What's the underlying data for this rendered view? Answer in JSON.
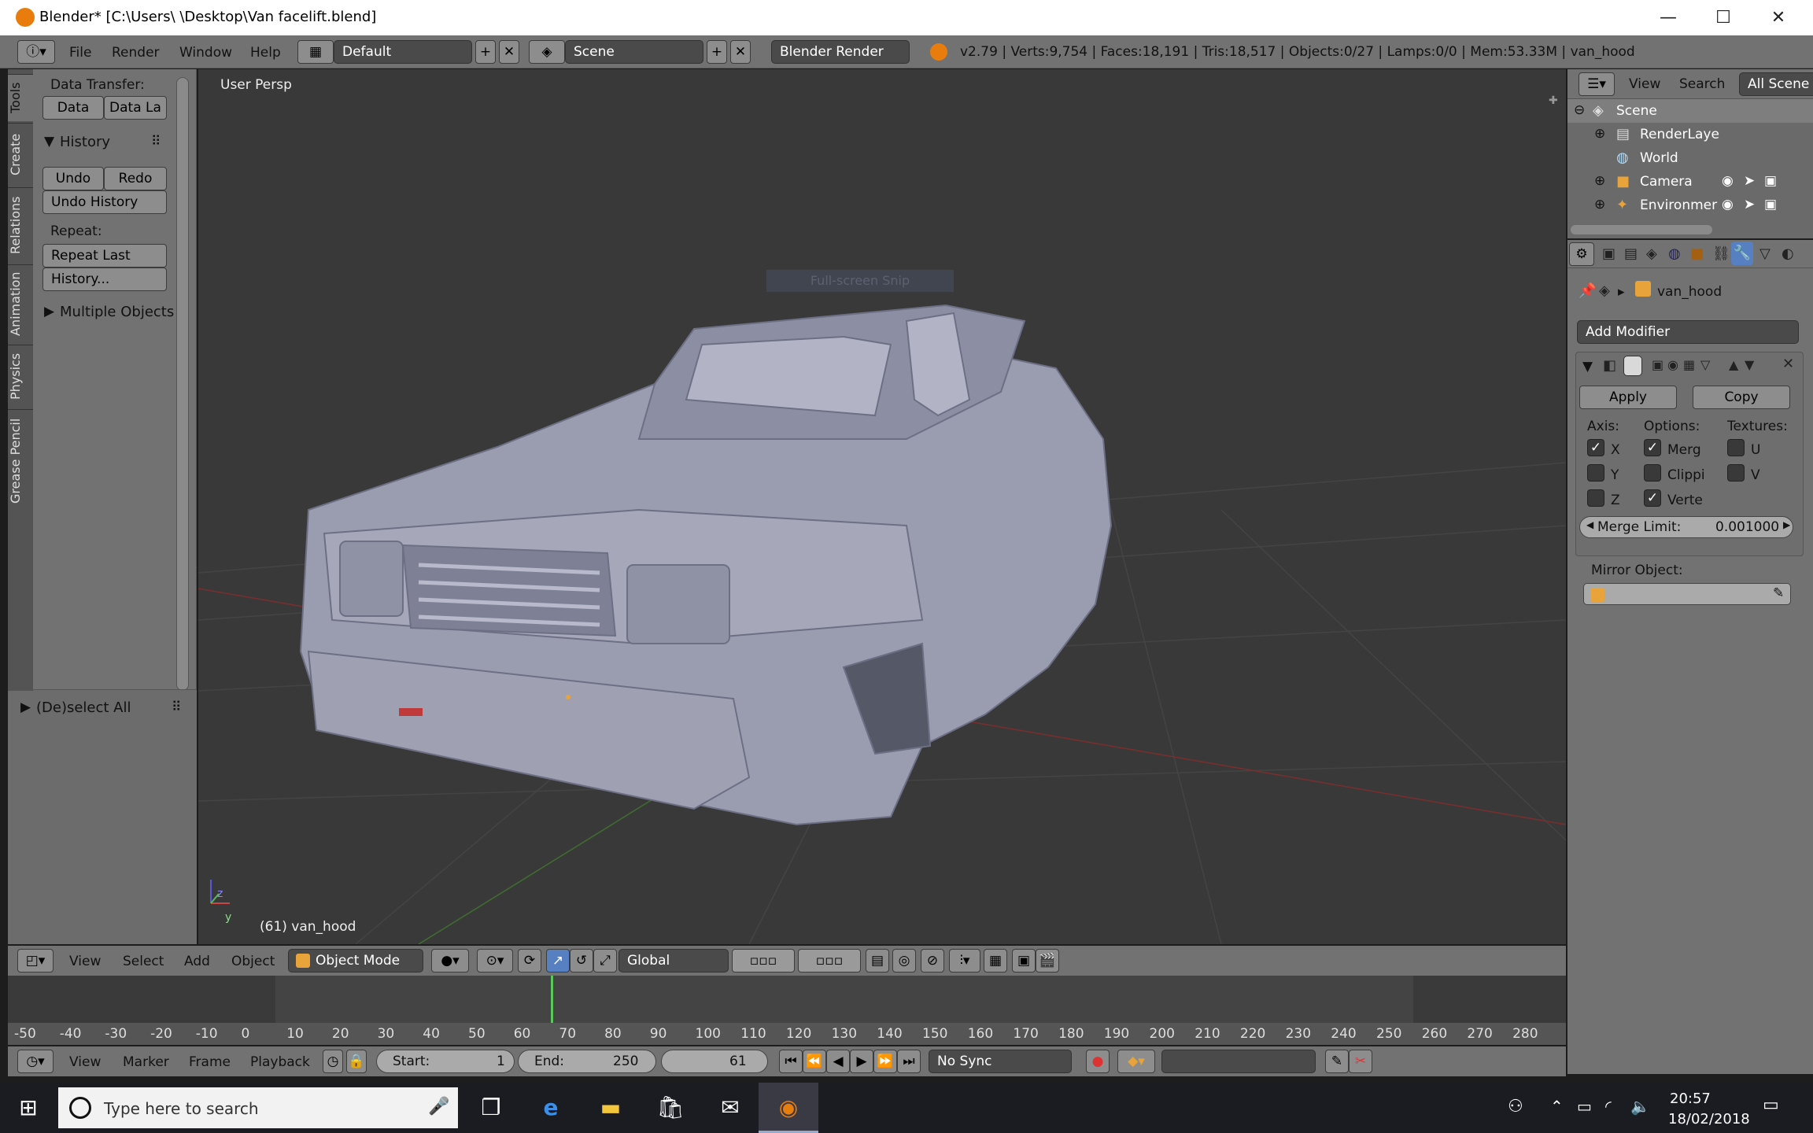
{
  "window": {
    "title": "Blender* [C:\\Users\\     \\Desktop\\Van facelift.blend]"
  },
  "topbar": {
    "menus": [
      "File",
      "Render",
      "Window",
      "Help"
    ],
    "screen_layout": "Default",
    "scene": "Scene",
    "render_engine": "Blender Render",
    "stats": "v2.79 | Verts:9,754 | Faces:18,191 | Tris:18,517 | Objects:0/27 | Lamps:0/0 | Mem:53.33M | van_hood"
  },
  "toolshelf": {
    "tabs": [
      "Tools",
      "Create",
      "Relations",
      "Animation",
      "Physics",
      "Grease Pencil"
    ],
    "data_transfer_label": "Data Transfer:",
    "data_button": "Data",
    "data_layers_button": "Data La",
    "history_panel": "History",
    "undo": "Undo",
    "redo": "Redo",
    "undo_history": "Undo History",
    "repeat_label": "Repeat:",
    "repeat_last": "Repeat Last",
    "history_dots": "History...",
    "multiple_objects": "Multiple Objects",
    "operator_panel": "(De)select All"
  },
  "viewport": {
    "view_label": "User Persp",
    "object_info": "(61) van_hood",
    "snip_overlay": "Full-screen Snip",
    "axis_z": "z",
    "axis_y": "y"
  },
  "outliner": {
    "menus": [
      "View",
      "Search"
    ],
    "filter": "All Scene",
    "items": [
      "Scene",
      "RenderLaye",
      "World",
      "Camera",
      "Environmer"
    ]
  },
  "properties": {
    "object_name": "van_hood",
    "add_modifier": "Add Modifier",
    "apply": "Apply",
    "copy": "Copy",
    "axis_label": "Axis:",
    "options_label": "Options:",
    "textures_label": "Textures:",
    "axes": [
      {
        "label": "X",
        "checked": true
      },
      {
        "label": "Y",
        "checked": false
      },
      {
        "label": "Z",
        "checked": false
      }
    ],
    "options": [
      {
        "label": "Merg",
        "checked": true
      },
      {
        "label": "Clippi",
        "checked": false
      },
      {
        "label": "Verte",
        "checked": true
      }
    ],
    "textures": [
      {
        "label": "U",
        "checked": false
      },
      {
        "label": "V",
        "checked": false
      }
    ],
    "merge_limit_label": "Merge Limit:",
    "merge_limit_value": "0.001000",
    "mirror_object_label": "Mirror Object:"
  },
  "view3d_header": {
    "menus": [
      "View",
      "Select",
      "Add",
      "Object"
    ],
    "mode": "Object Mode",
    "orientation": "Global"
  },
  "timeline": {
    "ticks": [
      "-50",
      "-40",
      "-30",
      "-20",
      "-10",
      "0",
      "10",
      "20",
      "30",
      "40",
      "50",
      "60",
      "70",
      "80",
      "90",
      "100",
      "110",
      "120",
      "130",
      "140",
      "150",
      "160",
      "170",
      "180",
      "190",
      "200",
      "210",
      "220",
      "230",
      "240",
      "250",
      "260",
      "270",
      "280"
    ],
    "current_frame_marker": 60,
    "menus": [
      "View",
      "Marker",
      "Frame",
      "Playback"
    ],
    "start_label": "Start:",
    "start": "1",
    "end_label": "End:",
    "end": "250",
    "current": "61",
    "sync": "No Sync"
  },
  "taskbar": {
    "search_placeholder": "Type here to search",
    "time": "20:57",
    "date": "18/02/2018"
  },
  "colors": {
    "accent_blue": "#5680c2",
    "blender_orange": "#e87d0d"
  }
}
